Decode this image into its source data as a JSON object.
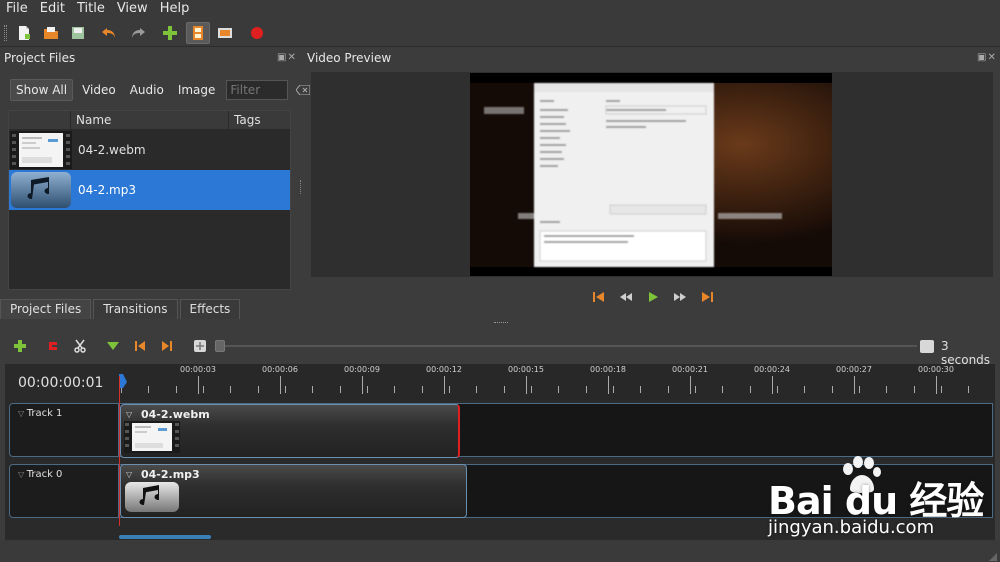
{
  "menu": [
    "File",
    "Edit",
    "Title",
    "View",
    "Help"
  ],
  "project_files": {
    "title": "Project Files",
    "filters": [
      "Show All",
      "Video",
      "Audio",
      "Image"
    ],
    "filter_placeholder": "Filter",
    "columns": [
      "Name",
      "Tags"
    ],
    "files": [
      {
        "name": "04-2.webm",
        "icon": "video-thumbnail-icon",
        "selected": false
      },
      {
        "name": "04-2.mp3",
        "icon": "music-note-icon",
        "selected": true
      }
    ],
    "tabs": [
      "Project Files",
      "Transitions",
      "Effects"
    ]
  },
  "video_preview": {
    "title": "Video Preview"
  },
  "timeline": {
    "timecode": "00:00:00:01",
    "zoom_label": "3 seconds",
    "ruler_labels": [
      "00:00:03",
      "00:00:06",
      "00:00:09",
      "00:00:12",
      "00:00:15",
      "00:00:18",
      "00:00:21",
      "00:00:24",
      "00:00:27",
      "00:00:30"
    ],
    "tracks": [
      {
        "name": "Track 1",
        "clip": "04-2.webm"
      },
      {
        "name": "Track 0",
        "clip": "04-2.mp3"
      }
    ]
  },
  "watermark": {
    "logo": "Bai du 经验",
    "url": "jingyan.baidu.com"
  },
  "colors": {
    "selection": "#2b78d6",
    "playhead": "#d43030",
    "clip_border": "#6a8fb0",
    "accent_orange": "#e8862a",
    "accent_green": "#7ec43a"
  }
}
